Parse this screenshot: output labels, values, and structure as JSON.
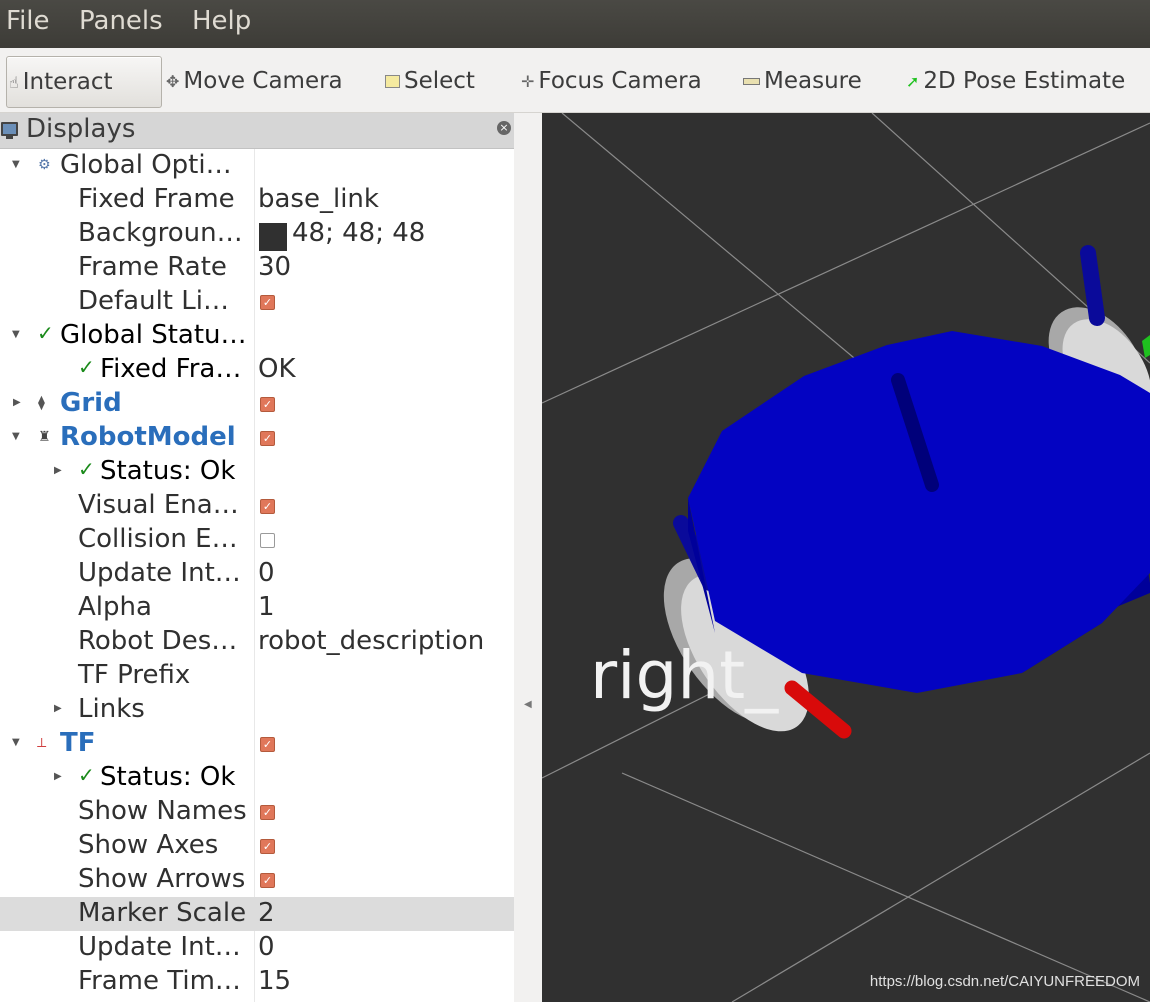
{
  "menu": [
    "File",
    "Panels",
    "Help"
  ],
  "toolbar": {
    "interact": "Interact",
    "move_camera": "Move Camera",
    "select": "Select",
    "focus_camera": "Focus Camera",
    "measure": "Measure",
    "pose_estimate": "2D Pose Estimate"
  },
  "panel": {
    "title": "Displays"
  },
  "tree": {
    "global_options": "Global Opti…",
    "fixed_frame_label": "Fixed Frame",
    "fixed_frame_value": "base_link",
    "background_label": "Backgroun…",
    "background_value": "48; 48; 48",
    "frame_rate_label": "Frame Rate",
    "frame_rate_value": "30",
    "default_light_label": "Default Li…",
    "global_status": "Global Statu…",
    "fixed_frame_status_label": "Fixed Fra…",
    "fixed_frame_status_value": "OK",
    "grid": "Grid",
    "robot_model": "RobotModel",
    "rm_status": "Status: Ok",
    "visual_enabled": "Visual Ena…",
    "collision_enabled": "Collision E…",
    "rm_update_interval": "Update Int…",
    "rm_update_interval_value": "0",
    "alpha": "Alpha",
    "alpha_value": "1",
    "robot_description": "Robot Des…",
    "robot_description_value": "robot_description",
    "tf_prefix": "TF Prefix",
    "links": "Links",
    "tf": "TF",
    "tf_status": "Status: Ok",
    "show_names": "Show Names",
    "show_axes": "Show Axes",
    "show_arrows": "Show Arrows",
    "marker_scale": "Marker Scale",
    "marker_scale_value": "2",
    "tf_update_interval": "Update Int…",
    "tf_update_interval_value": "0",
    "frame_timeout": "Frame Tim…",
    "frame_timeout_value": "15"
  },
  "viewport": {
    "frame_label": "right_",
    "watermark": "https://blog.csdn.net/CAIYUNFREEDOM"
  },
  "colors": {
    "background": "#303030",
    "accent": "#2a6ebb",
    "checkbox": "#e0775a"
  }
}
